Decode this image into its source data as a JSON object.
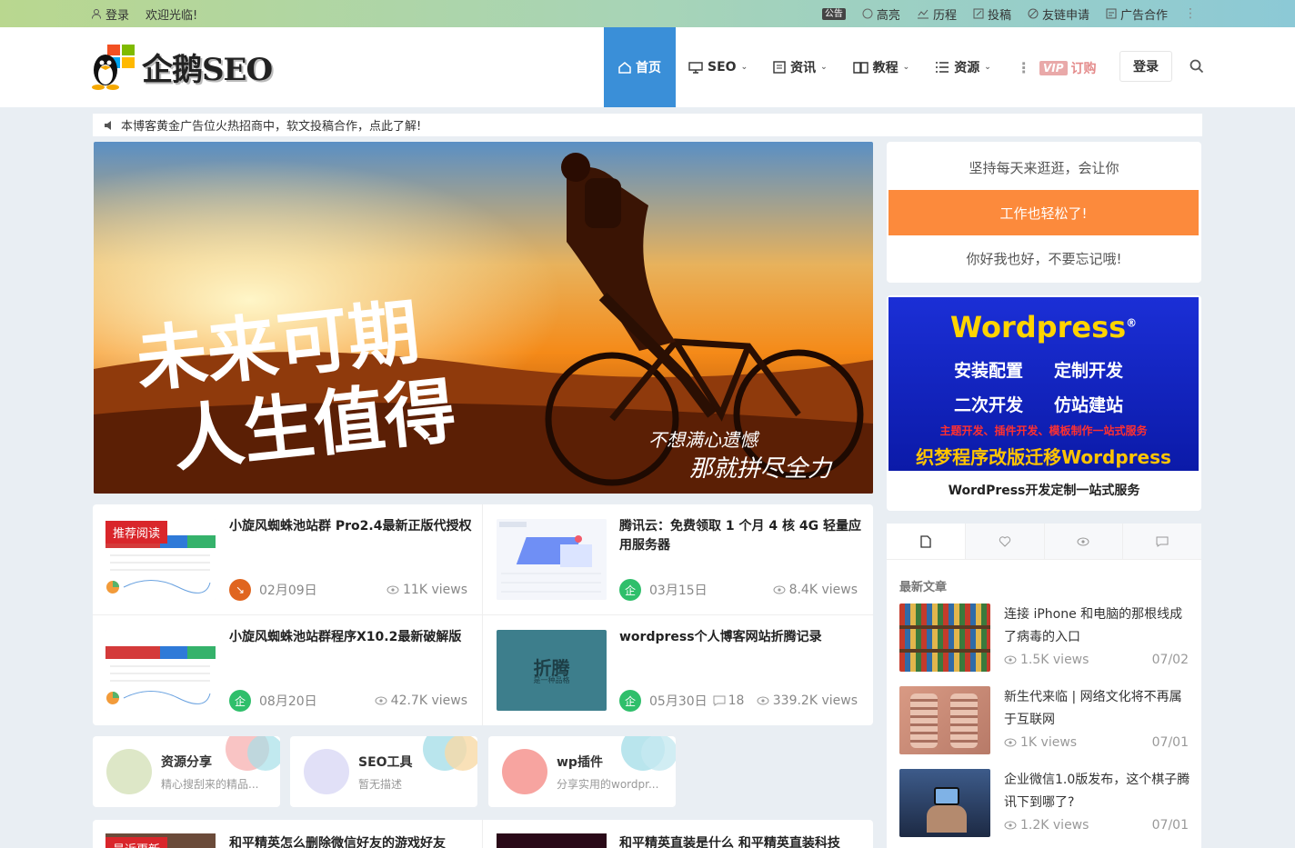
{
  "topbar": {
    "login": "登录",
    "welcome": "欢迎光临!",
    "notice_icon": "公告",
    "links": [
      {
        "label": "高亮",
        "icon": "highlight-icon"
      },
      {
        "label": "历程",
        "icon": "chart-icon"
      },
      {
        "label": "投稿",
        "icon": "edit-icon"
      },
      {
        "label": "友链申请",
        "icon": "link-icon"
      },
      {
        "label": "广告合作",
        "icon": "ad-icon"
      }
    ]
  },
  "header": {
    "logo_text": "企鹅SEO",
    "nav": [
      {
        "label": "首页",
        "icon": "home-icon",
        "active": true
      },
      {
        "label": "SEO",
        "icon": "monitor-icon",
        "dropdown": true
      },
      {
        "label": "资讯",
        "icon": "news-icon",
        "dropdown": true
      },
      {
        "label": "教程",
        "icon": "book-icon",
        "dropdown": true
      },
      {
        "label": "资源",
        "icon": "list-icon",
        "dropdown": true
      }
    ],
    "vip_badge": "VIP",
    "vip_label": "订购",
    "login_button": "登录"
  },
  "notice": {
    "text": "本博客黄金广告位火热招商中，软文投稿合作，点此了解!"
  },
  "banner": {
    "line1": "未来可期",
    "line2": "人生值得",
    "sub1": "不想满心遗憾",
    "sub2": "那就拼尽全力"
  },
  "posts": [
    {
      "title": "小旋风蜘蛛池站群 Pro2.4最新正版代授权",
      "tag": "推荐阅读",
      "date": "02月09日",
      "views": "11K views",
      "avatar_color": "#e0651f"
    },
    {
      "title": "腾讯云：免费领取 1 个月 4 核 4G 轻量应用服务器",
      "date": "03月15日",
      "views": "8.4K views",
      "avatar_color": "#2fbf6b"
    },
    {
      "title": "小旋风蜘蛛池站群程序X10.2最新破解版",
      "date": "08月20日",
      "views": "42.7K views",
      "avatar_color": "#2fbf6b"
    },
    {
      "title": "wordpress个人博客网站折腾记录",
      "date": "05月30日",
      "comments": "18",
      "views": "339.2K views",
      "avatar_color": "#2fbf6b",
      "thumb_text": "折腾",
      "thumb_sub": "是一种品格"
    }
  ],
  "categories": [
    {
      "title": "资源分享",
      "desc": "精心搜刮来的精品...",
      "color": "#dde7c7"
    },
    {
      "title": "SEO工具",
      "desc": "暂无描述",
      "color": "#e1e0f7"
    },
    {
      "title": "wp插件",
      "desc": "分享实用的wordpr...",
      "color": "#f7a4a0"
    }
  ],
  "bottom_posts": [
    {
      "title": "和平精英怎么删除微信好友的游戏好友",
      "tag": "最近更新"
    },
    {
      "title": "和平精英直装是什么 和平精英直装科技"
    }
  ],
  "sidebar": {
    "promo_line1": "坚持每天来逛逛，会让你",
    "promo_button": "工作也轻松了!",
    "promo_line2": "你好我也好，不要忘记哦!",
    "ad": {
      "brand": "Wordpress",
      "reg": "®",
      "items": [
        "安装配置",
        "定制开发",
        "二次开发",
        "仿站建站"
      ],
      "red_line": "主题开发、插件开发、模板制作一站式服务",
      "bottom": "织梦程序改版迁移Wordpress",
      "caption": "WordPress开发定制一站式服务"
    },
    "latest_title": "最新文章",
    "latest": [
      {
        "title": "连接 iPhone 和电脑的那根线成了病毒的入口",
        "views": "1.5K views",
        "date": "07/02"
      },
      {
        "title": "新生代来临 | 网络文化将不再属于互联网",
        "views": "1K views",
        "date": "07/01"
      },
      {
        "title": "企业微信1.0版发布，这个棋子腾讯下到哪了?",
        "views": "1.2K views",
        "date": "07/01"
      }
    ]
  }
}
